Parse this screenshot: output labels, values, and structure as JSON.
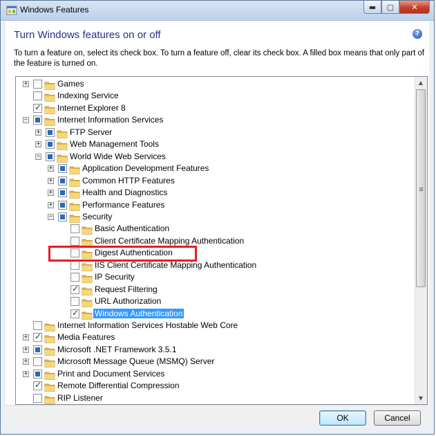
{
  "window": {
    "title": "Windows Features",
    "minimize": "▬",
    "maximize": "▢",
    "close": "✕"
  },
  "dialog": {
    "heading": "Turn Windows features on or off",
    "help": "?",
    "description": "To turn a feature on, select its check box. To turn a feature off, clear its check box. A filled box means that only part of the feature is turned on."
  },
  "tree": {
    "items": [
      {
        "label": "Games",
        "level": 0,
        "expander": "+",
        "state": "unchecked",
        "icon": "folder-icon"
      },
      {
        "label": "Indexing Service",
        "level": 0,
        "expander": "",
        "state": "unchecked",
        "icon": "folder-icon"
      },
      {
        "label": "Internet Explorer 8",
        "level": 0,
        "expander": "",
        "state": "checked",
        "icon": "folder-icon"
      },
      {
        "label": "Internet Information Services",
        "level": 0,
        "expander": "−",
        "state": "partial",
        "icon": "folder-icon"
      },
      {
        "label": "FTP Server",
        "level": 1,
        "expander": "+",
        "state": "partial",
        "icon": "folder-icon"
      },
      {
        "label": "Web Management Tools",
        "level": 1,
        "expander": "+",
        "state": "partial",
        "icon": "folder-icon"
      },
      {
        "label": "World Wide Web Services",
        "level": 1,
        "expander": "−",
        "state": "partial",
        "icon": "folder-icon"
      },
      {
        "label": "Application Development Features",
        "level": 2,
        "expander": "+",
        "state": "partial",
        "icon": "folder-icon"
      },
      {
        "label": "Common HTTP Features",
        "level": 2,
        "expander": "+",
        "state": "partial",
        "icon": "folder-icon"
      },
      {
        "label": "Health and Diagnostics",
        "level": 2,
        "expander": "+",
        "state": "partial",
        "icon": "folder-icon"
      },
      {
        "label": "Performance Features",
        "level": 2,
        "expander": "+",
        "state": "partial",
        "icon": "folder-icon"
      },
      {
        "label": "Security",
        "level": 2,
        "expander": "−",
        "state": "partial",
        "icon": "folder-icon"
      },
      {
        "label": "Basic Authentication",
        "level": 3,
        "expander": "",
        "state": "unchecked",
        "icon": "folder-icon"
      },
      {
        "label": "Client Certificate Mapping Authentication",
        "level": 3,
        "expander": "",
        "state": "unchecked",
        "icon": "folder-icon"
      },
      {
        "label": "Digest Authentication",
        "level": 3,
        "expander": "",
        "state": "unchecked",
        "icon": "folder-icon"
      },
      {
        "label": "IIS Client Certificate Mapping Authentication",
        "level": 3,
        "expander": "",
        "state": "unchecked",
        "icon": "folder-icon"
      },
      {
        "label": "IP Security",
        "level": 3,
        "expander": "",
        "state": "unchecked",
        "icon": "folder-icon"
      },
      {
        "label": "Request Filtering",
        "level": 3,
        "expander": "",
        "state": "checked",
        "icon": "folder-icon"
      },
      {
        "label": "URL Authorization",
        "level": 3,
        "expander": "",
        "state": "unchecked",
        "icon": "folder-icon"
      },
      {
        "label": "Windows Authentication",
        "level": 3,
        "expander": "",
        "state": "checked",
        "icon": "folder-icon",
        "selected": true
      },
      {
        "label": "Internet Information Services Hostable Web Core",
        "level": 0,
        "expander": "",
        "state": "unchecked",
        "icon": "folder-icon"
      },
      {
        "label": "Media Features",
        "level": 0,
        "expander": "+",
        "state": "checked",
        "icon": "folder-icon"
      },
      {
        "label": "Microsoft .NET Framework 3.5.1",
        "level": 0,
        "expander": "+",
        "state": "partial",
        "icon": "folder-icon"
      },
      {
        "label": "Microsoft Message Queue (MSMQ) Server",
        "level": 0,
        "expander": "+",
        "state": "unchecked",
        "icon": "folder-icon"
      },
      {
        "label": "Print and Document Services",
        "level": 0,
        "expander": "+",
        "state": "partial",
        "icon": "folder-icon"
      },
      {
        "label": "Remote Differential Compression",
        "level": 0,
        "expander": "",
        "state": "checked",
        "icon": "folder-icon"
      },
      {
        "label": "RIP Listener",
        "level": 0,
        "expander": "",
        "state": "unchecked",
        "icon": "folder-icon"
      }
    ]
  },
  "scrollbar": {
    "up": "▲",
    "down": "▼"
  },
  "buttons": {
    "ok": "OK",
    "cancel": "Cancel"
  },
  "colors": {
    "selection": "#3399ff",
    "highlight_annotation": "#e81c24",
    "heading": "#1e3287"
  }
}
